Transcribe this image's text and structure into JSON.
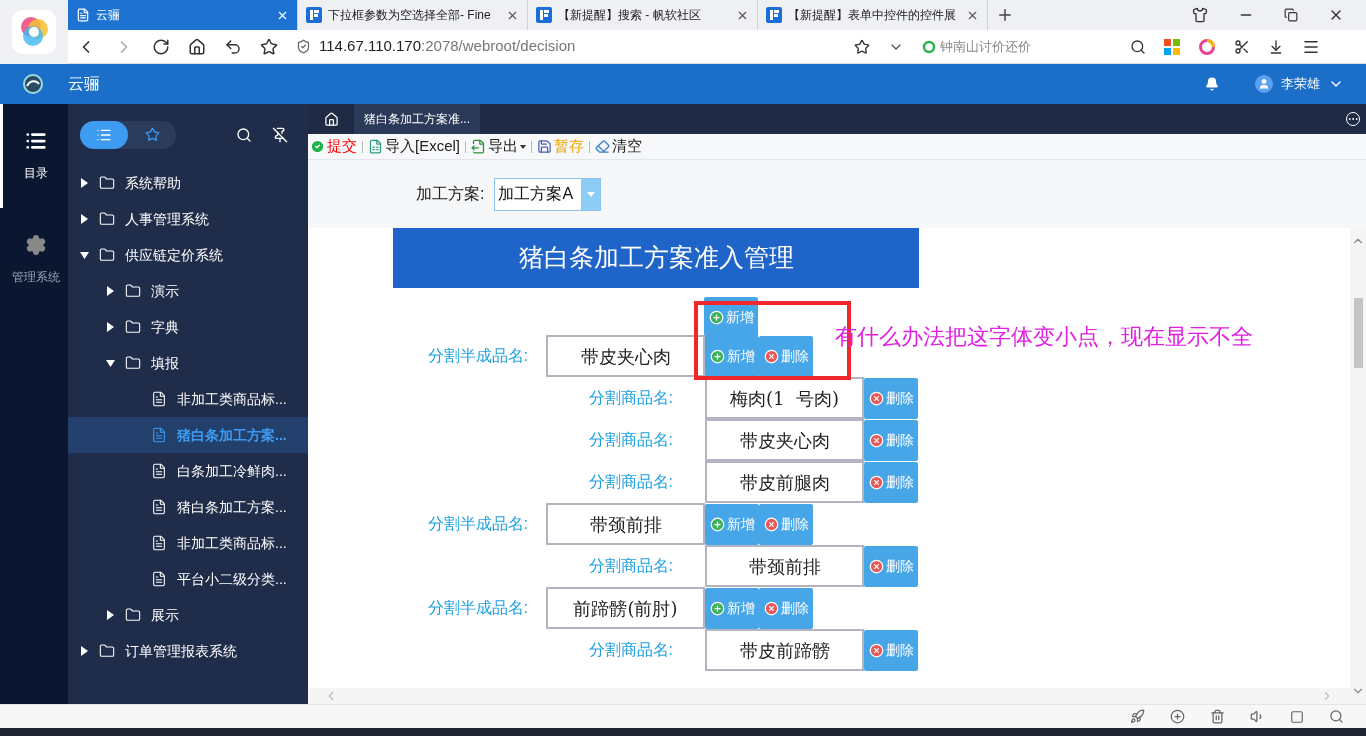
{
  "browser": {
    "tabs": [
      {
        "title": "云骊",
        "selected": true
      },
      {
        "title": "下拉框参数为空选择全部- Fine",
        "selected": false
      },
      {
        "title": "【新提醒】搜索 - 帆软社区",
        "selected": false
      },
      {
        "title": "【新提醒】表单中控件的控件展",
        "selected": false
      }
    ],
    "address": {
      "host": "114.67.110.170",
      "path": ":2078/webroot/decision"
    },
    "search": "钟南山讨价还价"
  },
  "app": {
    "title": "云骊",
    "user": "李荣雄"
  },
  "rail": [
    {
      "label": "目录",
      "selected": true,
      "kind": "catalog"
    },
    {
      "label": "管理系统",
      "selected": false,
      "kind": "settings"
    }
  ],
  "sidebar": {
    "tree": [
      {
        "label": "系统帮助",
        "kind": "folder",
        "expanded": false,
        "selected": false
      },
      {
        "label": "人事管理系统",
        "kind": "folder",
        "expanded": false,
        "selected": false
      },
      {
        "label": "供应链定价系统",
        "kind": "folder",
        "expanded": true,
        "selected": false,
        "children": [
          {
            "label": "演示",
            "kind": "folder",
            "expanded": false,
            "selected": false
          },
          {
            "label": "字典",
            "kind": "folder",
            "expanded": false,
            "selected": false
          },
          {
            "label": "填报",
            "kind": "folder",
            "expanded": true,
            "selected": false,
            "children": [
              {
                "label": "非加工类商品标...",
                "kind": "file",
                "selected": false
              },
              {
                "label": "猪白条加工方案...",
                "kind": "file",
                "selected": true
              },
              {
                "label": "白条加工冷鲜肉...",
                "kind": "file",
                "selected": false
              },
              {
                "label": "猪白条加工方案...",
                "kind": "file",
                "selected": false
              },
              {
                "label": "非加工类商品标...",
                "kind": "file",
                "selected": false
              },
              {
                "label": "平台小二级分类...",
                "kind": "file",
                "selected": false
              }
            ]
          },
          {
            "label": "展示",
            "kind": "folder",
            "expanded": false,
            "selected": false
          }
        ]
      },
      {
        "label": "订单管理报表系统",
        "kind": "folder",
        "expanded": false,
        "selected": false
      }
    ]
  },
  "content_tabs": [
    {
      "label": "猪白条加工方案准...",
      "selected": true
    }
  ],
  "toolbar": [
    {
      "label": "提交",
      "kind": "submit"
    },
    {
      "label": "导入[Excel]",
      "kind": "import"
    },
    {
      "label": "导出",
      "kind": "export"
    },
    {
      "label": "暂存",
      "kind": "save"
    },
    {
      "label": "清空",
      "kind": "clear"
    }
  ],
  "params": {
    "label": "加工方案:",
    "value": "加工方案A"
  },
  "report": {
    "title": "猪白条加工方案准入管理",
    "rows": [
      {
        "kind": "add",
        "buttons": [
          {
            "label": "新增",
            "kind": "add"
          }
        ]
      },
      {
        "kind": "semi",
        "label": "分割半成品名:",
        "value": "带皮夹心肉",
        "buttons": [
          {
            "label": "新增",
            "kind": "add"
          },
          {
            "label": "删除",
            "kind": "delete"
          }
        ]
      },
      {
        "kind": "product",
        "label": "分割商品名:",
        "value": "梅肉(1  号肉)",
        "buttons": [
          {
            "label": "删除",
            "kind": "delete"
          }
        ]
      },
      {
        "kind": "product",
        "label": "分割商品名:",
        "value": "带皮夹心肉",
        "buttons": [
          {
            "label": "删除",
            "kind": "delete"
          }
        ]
      },
      {
        "kind": "product",
        "label": "分割商品名:",
        "value": "带皮前腿肉",
        "buttons": [
          {
            "label": "删除",
            "kind": "delete"
          }
        ]
      },
      {
        "kind": "semi",
        "label": "分割半成品名:",
        "value": "带颈前排",
        "buttons": [
          {
            "label": "新增",
            "kind": "add"
          },
          {
            "label": "删除",
            "kind": "delete"
          }
        ]
      },
      {
        "kind": "product",
        "label": "分割商品名:",
        "value": "带颈前排",
        "buttons": [
          {
            "label": "删除",
            "kind": "delete"
          }
        ]
      },
      {
        "kind": "semi",
        "label": "分割半成品名:",
        "value": "前蹄髈(前肘)",
        "buttons": [
          {
            "label": "新增",
            "kind": "add"
          },
          {
            "label": "删除",
            "kind": "delete"
          }
        ]
      },
      {
        "kind": "product",
        "label": "分割商品名:",
        "value": "带皮前蹄髈",
        "buttons": [
          {
            "label": "删除",
            "kind": "delete"
          }
        ]
      }
    ]
  },
  "annotation": {
    "text": "有什么办法把这字体变小点，现在显示不全"
  }
}
